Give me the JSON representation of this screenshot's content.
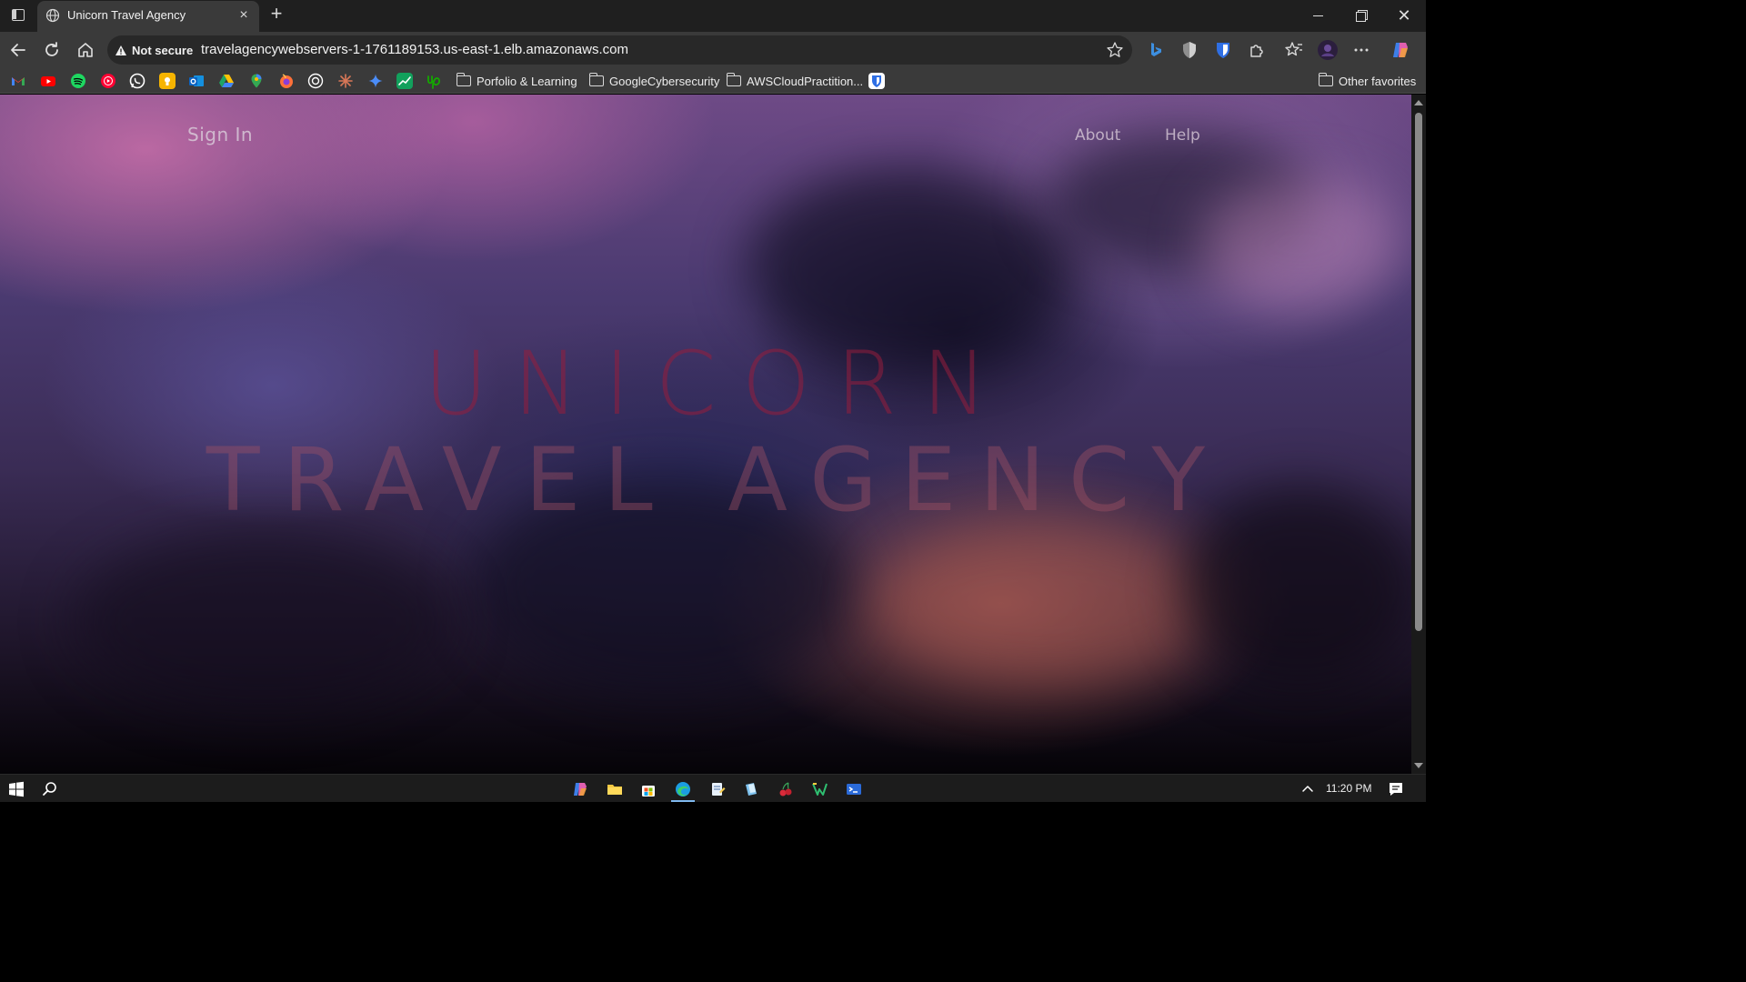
{
  "browser": {
    "tab": {
      "title": "Unicorn Travel Agency",
      "favicon": "globe-icon"
    },
    "security_label": "Not secure",
    "url": "travelagencywebservers-1-1761189153.us-east-1.elb.amazonaws.com",
    "favorites_folders": [
      {
        "label": "Porfolio & Learning"
      },
      {
        "label": "GoogleCybersecurity"
      },
      {
        "label": "AWSCloudPractition..."
      }
    ],
    "other_favorites": "Other favorites"
  },
  "page": {
    "nav": {
      "sign_in": "Sign In",
      "about": "About",
      "help": "Help"
    },
    "hero": {
      "line1": "UNICORN",
      "line2": "TRAVEL AGENCY"
    }
  },
  "taskbar": {
    "clock": "11:20 PM"
  },
  "colors": {
    "hero_line1": "#961e3c",
    "hero_line2": "#a05064",
    "nav_text": "#d7c8d7",
    "tab_strip": "#1f1f1f",
    "toolbar": "#3a3a3a"
  }
}
